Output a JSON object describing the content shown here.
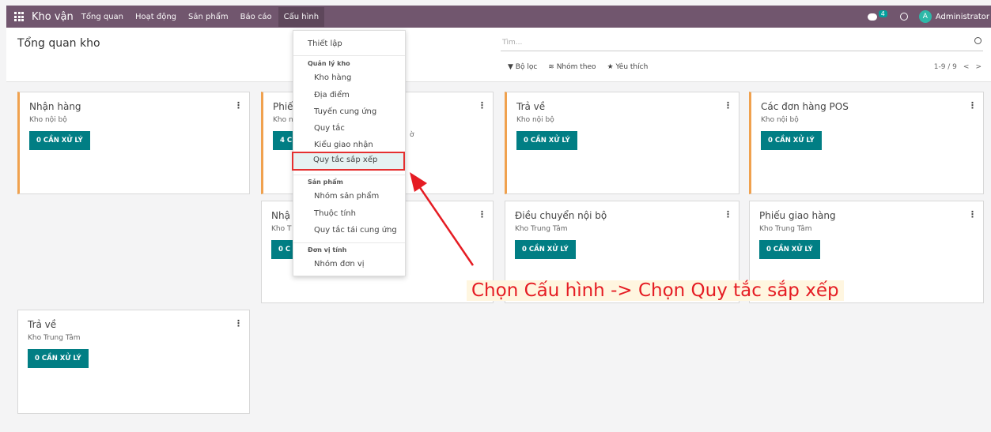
{
  "navbar": {
    "app_title": "Kho vận",
    "menus": [
      "Tổng quan",
      "Hoạt động",
      "Sản phẩm",
      "Báo cáo",
      "Cấu hình"
    ],
    "chat_count": "4",
    "avatar_letter": "A",
    "user": "Administrator"
  },
  "control_panel": {
    "title": "Tổng quan kho",
    "search_placeholder": "Tìm...",
    "filter": "Bộ lọc",
    "group_by": "Nhóm theo",
    "favorites": "Yêu thích",
    "pager": "1-9 / 9"
  },
  "cards": [
    {
      "title": "Nhận hàng",
      "subtitle": "Kho nội bộ",
      "button": "0 CẦN XỬ LÝ"
    },
    {
      "title": "Phiế",
      "subtitle": "Kho n",
      "button": "4 C",
      "extra": "ờ"
    },
    {
      "title": "Trả về",
      "subtitle": "Kho nội bộ",
      "button": "0 CẦN XỬ LÝ"
    },
    {
      "title": "Các đơn hàng POS",
      "subtitle": "Kho nội bộ",
      "button": "0 CẦN XỬ LÝ"
    },
    {
      "title": "Nhậ",
      "subtitle": "Kho T",
      "button": "0 C"
    },
    {
      "title": "Điều chuyển nội bộ",
      "subtitle": "Kho Trung Tâm",
      "button": "0 CẦN XỬ LÝ"
    },
    {
      "title": "Phiếu giao hàng",
      "subtitle": "Kho Trung Tâm",
      "button": "0 CẦN XỬ LÝ"
    },
    {
      "title": "Trả về",
      "subtitle": "Kho Trung Tâm",
      "button": "0 CẦN XỬ LÝ"
    }
  ],
  "config_menu": {
    "setup": "Thiết lập",
    "warehouse_header": "Quản lý kho",
    "warehouse_items": [
      "Kho hàng",
      "Địa điểm",
      "Tuyến cung ứng",
      "Quy tắc",
      "Kiểu giao nhận",
      "Quy tắc sắp xếp"
    ],
    "product_header": "Sản phẩm",
    "product_items": [
      "Nhóm sản phẩm",
      "Thuộc tính",
      "Quy tắc tái cung ứng"
    ],
    "uom_header": "Đơn vị tính",
    "uom_items": [
      "Nhóm đơn vị"
    ]
  },
  "annotation": {
    "text": "Chọn Cấu hình -> Chọn Quy tắc sắp xếp",
    "color": "#e51c23"
  },
  "colors": {
    "navbar": "#71566e",
    "primary_button": "#017e84",
    "card_accent": "#f0a14e"
  }
}
